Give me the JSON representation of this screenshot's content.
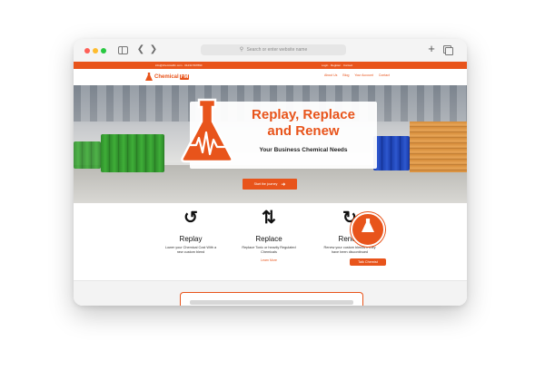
{
  "browser": {
    "address_placeholder": "Search or enter website name"
  },
  "site": {
    "topbar_left": "info@chemicalfm.com  ·  01234 567890",
    "topbar_right": "Login  ·  Register  ·  Contact",
    "logo_text": "Chemical",
    "logo_highlight": "FM",
    "nav": [
      "About Us",
      "Blog",
      "Your Account",
      "Contact"
    ]
  },
  "hero": {
    "title_line1": "Replay, Replace",
    "title_line2": "and Renew",
    "subtitle": "Your Business Chemical Needs",
    "cta_label": "Start the journey"
  },
  "services": [
    {
      "icon": "replay-icon",
      "name": "Replay",
      "description": "Lower your Chemical Cost With a new custom blend"
    },
    {
      "icon": "replace-icon",
      "name": "Replace",
      "description": "Replace Toxic or heavily Regulated Chemicals",
      "link": "Learn More"
    },
    {
      "icon": "renew-icon",
      "name": "Renew",
      "description": "Renew your custom blends if they have been discontinued"
    }
  ],
  "badge": {
    "label": "Talk Chemist"
  },
  "colors": {
    "brand": "#e8541b"
  }
}
